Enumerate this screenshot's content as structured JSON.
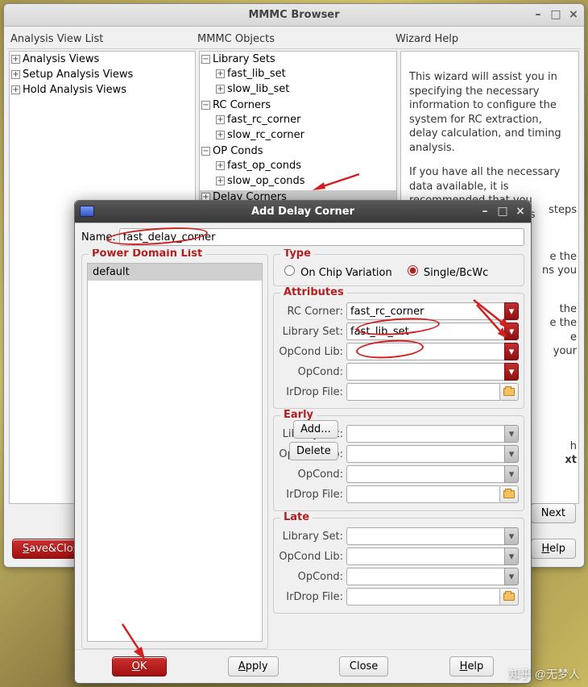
{
  "main": {
    "title": "MMMC Browser",
    "sections": {
      "analysis": "Analysis View List",
      "objects": "MMMC Objects",
      "help": "Wizard Help"
    },
    "analysis_tree": {
      "items": [
        {
          "label": "Analysis Views"
        },
        {
          "label": "Setup Analysis Views"
        },
        {
          "label": "Hold Analysis Views"
        }
      ]
    },
    "objects_tree": {
      "lib_sets": {
        "label": "Library Sets",
        "children": [
          "fast_lib_set",
          "slow_lib_set"
        ]
      },
      "rc_corners": {
        "label": "RC Corners",
        "children": [
          "fast_rc_corner",
          "slow_rc_corner"
        ]
      },
      "op_conds": {
        "label": "OP Conds",
        "children": [
          "fast_op_conds",
          "slow_op_conds"
        ]
      },
      "delay_corners": {
        "label": "Delay Corners"
      }
    },
    "help_text": {
      "p1": "This wizard will assist you in specifying the necessary information to configure the system for RC extraction, delay calculation, and timing analysis.",
      "p2": "If you have all the necessary data available, it is recommended that you configure the system as",
      "p2_tail": "steps",
      "p3_tail1": "e the",
      "p3_tail2": "ns you",
      "p4_tail1": "the",
      "p4_tail2": "e the",
      "p4_tail3": "e",
      "p4_tail4": "your",
      "p5_tail1": "h",
      "p5_tail2": "xt"
    },
    "buttons": {
      "save_close": "Save&Close...",
      "next": "Next",
      "help": "Help"
    }
  },
  "dialog": {
    "title": "Add Delay Corner",
    "name_label": "Name:",
    "name_value": "fast_delay_corner",
    "pdl": {
      "legend": "Power Domain List",
      "items": [
        "default"
      ],
      "add": "Add...",
      "delete": "Delete"
    },
    "type": {
      "legend": "Type",
      "ocv": "On Chip Variation",
      "sbw": "Single/BcWc",
      "selected": "sbw"
    },
    "attrs": {
      "legend": "Attributes",
      "rc_corner": {
        "label": "RC Corner:",
        "value": "fast_rc_corner"
      },
      "lib_set": {
        "label": "Library Set:",
        "value": "fast_lib_set"
      },
      "opcond_lib": {
        "label": "OpCond Lib:",
        "value": ""
      },
      "opcond": {
        "label": "OpCond:",
        "value": ""
      },
      "irdrop": {
        "label": "IrDrop File:",
        "value": ""
      }
    },
    "early": {
      "legend": "Early",
      "lib_set": {
        "label": "Library Set:",
        "value": ""
      },
      "opcond_lib": {
        "label": "OpCond Lib:",
        "value": ""
      },
      "opcond": {
        "label": "OpCond:",
        "value": ""
      },
      "irdrop": {
        "label": "IrDrop File:",
        "value": ""
      }
    },
    "late": {
      "legend": "Late",
      "lib_set": {
        "label": "Library Set:",
        "value": ""
      },
      "opcond_lib": {
        "label": "OpCond Lib:",
        "value": ""
      },
      "opcond": {
        "label": "OpCond:",
        "value": ""
      },
      "irdrop": {
        "label": "IrDrop File:",
        "value": ""
      }
    },
    "buttons": {
      "ok": "OK",
      "apply": "Apply",
      "close": "Close",
      "help": "Help"
    }
  },
  "watermark": "知乎 @无梦人"
}
